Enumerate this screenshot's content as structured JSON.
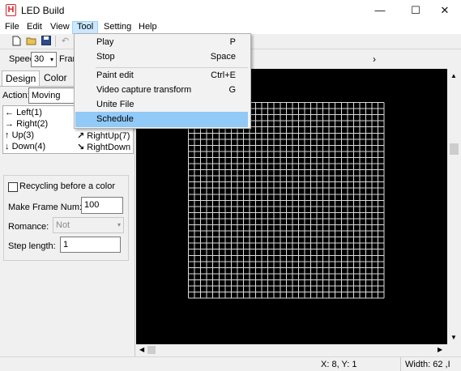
{
  "window": {
    "title": "LED Build",
    "icon_letter": "H",
    "minimize": "—",
    "maximize": "☐",
    "close": "✕"
  },
  "menu": [
    "File",
    "Edit",
    "View",
    "Tool",
    "Setting",
    "Help"
  ],
  "toolbar": {
    "speed_label": "Speed:",
    "speed_value": "30",
    "frame_label_partial": "Fran"
  },
  "tool_menu": [
    {
      "label": "Play",
      "shortcut": "P"
    },
    {
      "label": "Stop",
      "shortcut": "Space"
    },
    {
      "label": "Paint edit",
      "shortcut": "Ctrl+E"
    },
    {
      "label": "Video capture transform",
      "shortcut": "G"
    },
    {
      "label": "Unite File",
      "shortcut": ""
    },
    {
      "label": "Schedule",
      "shortcut": ""
    }
  ],
  "left_panel": {
    "tabs": [
      "Design",
      "Color"
    ],
    "action_label": "Action:",
    "action_value": "Moving",
    "directions": [
      {
        "arrow": "←",
        "label": "Left(1)"
      },
      {
        "arrow": "→",
        "label": "Right(2)"
      },
      {
        "arrow": "↑",
        "label": "Up(3)"
      },
      {
        "arrow": "↓",
        "label": "Down(4)"
      },
      {
        "arrow": "↗",
        "label": "RightUp(7)"
      },
      {
        "arrow": "↘",
        "label": "RightDown"
      }
    ],
    "recycling_label": "Recycling before a color",
    "make_frame_label": "Make Frame Num:",
    "make_frame_value": "100",
    "romance_label": "Romance:",
    "romance_value": "Not",
    "step_label": "Step length:",
    "step_value": "1"
  },
  "status": {
    "coords": "X: 8, Y: 1",
    "size": "Width: 62 ,I"
  },
  "colors": {
    "canvas": "#000000",
    "grid": "#ffffff",
    "highlight": "#91c9f7"
  }
}
